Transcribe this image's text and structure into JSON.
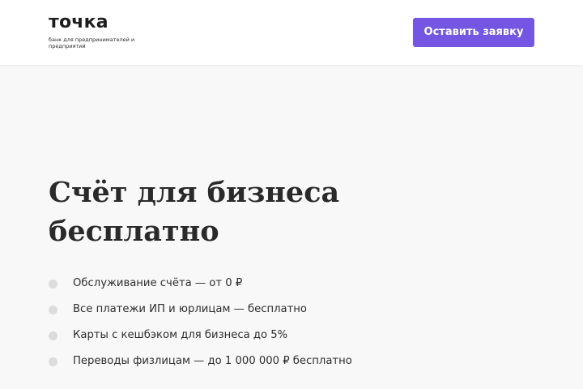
{
  "header": {
    "logo": {
      "name": "точка",
      "tagline": "банк для предпринимателей и предприятий"
    },
    "cta_label": "Оставить заявку"
  },
  "hero": {
    "title_line1": "Счёт для бизнеса",
    "title_line2": "бесплатно",
    "features": [
      "Обслуживание счёта — от 0 ₽",
      "Все платежи ИП и юрлицам — бесплатно",
      "Карты с кешбэком для бизнеса до 5%",
      "Переводы физлицам — до 1 000 000 ₽ бесплатно"
    ]
  },
  "colors": {
    "accent": "#7556e3",
    "page_background": "#f8f8f8",
    "header_background": "#ffffff",
    "text": "#2a2a2a",
    "bullet": "#dcdcdc"
  }
}
